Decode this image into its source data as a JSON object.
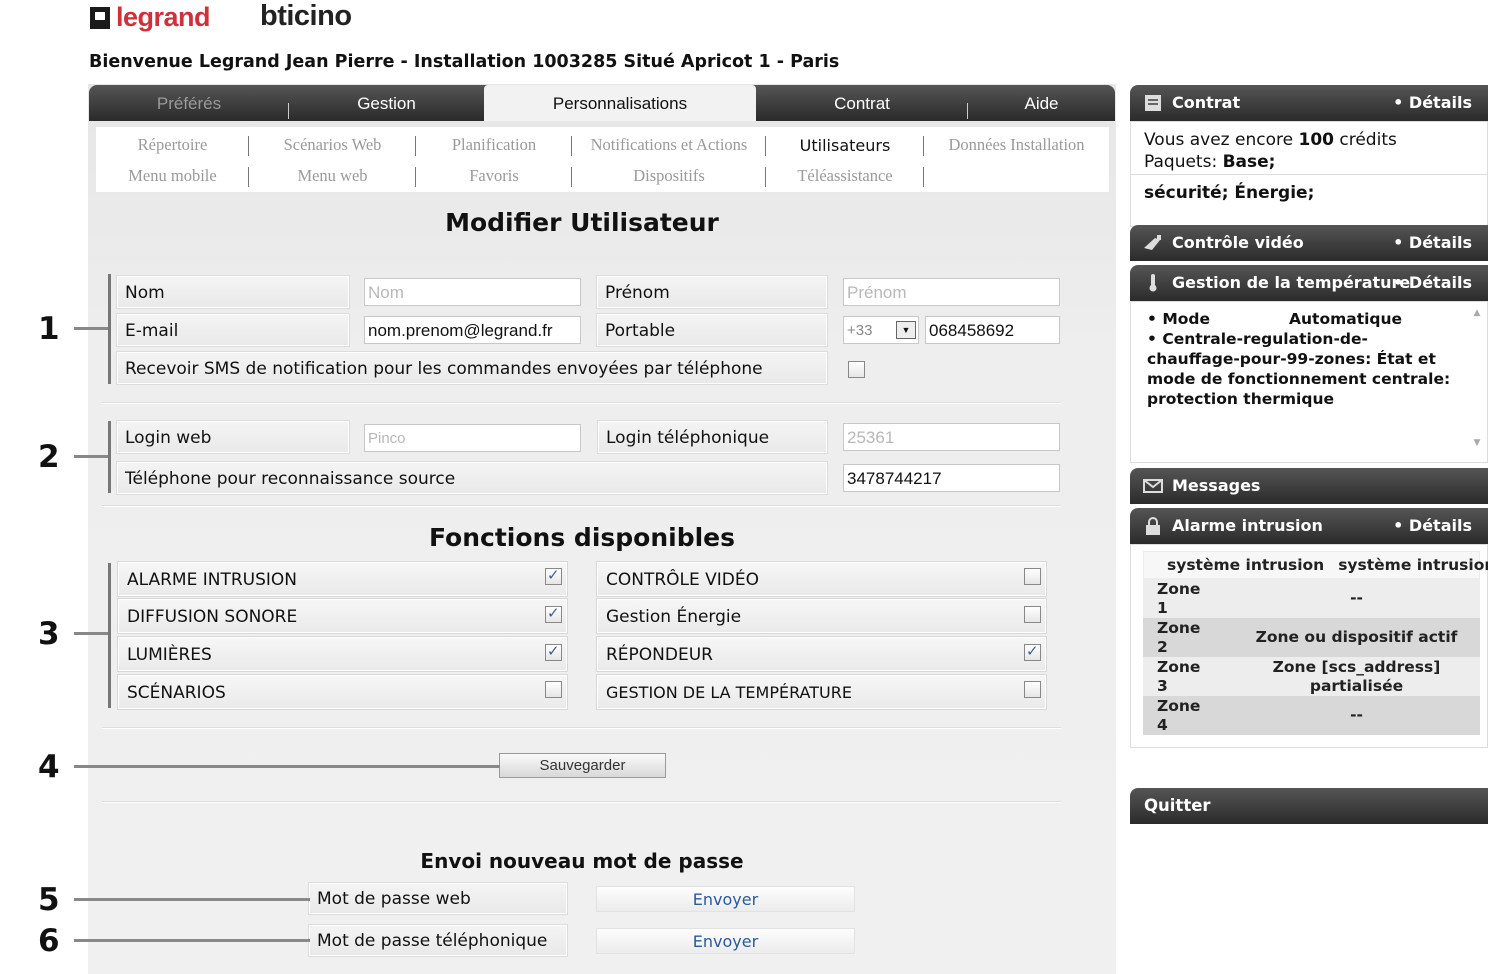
{
  "brand": {
    "logo1": "legrand",
    "logo2": "bticino"
  },
  "welcome": "Bienvenue Legrand Jean Pierre - Installation 1003285 Situé Apricot 1 - Paris",
  "tabs": [
    "Préférés",
    "Gestion",
    "Personnalisations",
    "Contrat",
    "Aide"
  ],
  "subnav": {
    "row1": [
      "Répertoire",
      "Scénarios Web",
      "Planification",
      "Notifications et Actions",
      "Utilisateurs",
      "Données Installation"
    ],
    "row2": [
      "Menu mobile",
      "Menu web",
      "Favoris",
      "Dispositifs",
      "Téléassistance"
    ]
  },
  "form": {
    "title": "Modifier Utilisateur",
    "nom_label": "Nom",
    "nom_placeholder": "Nom",
    "prenom_label": "Prénom",
    "prenom_placeholder": "Prénom",
    "email_label": "E-mail",
    "email_value": "nom.prenom@legrand.fr",
    "portable_label": "Portable",
    "country_code": "+33",
    "portable_value": "068458692",
    "sms_label": "Recevoir SMS de notification pour les commandes envoyées par téléphone",
    "login_web_label": "Login web",
    "login_web_placeholder": "Pinco",
    "login_tel_label": "Login téléphonique",
    "login_tel_value": "25361",
    "tel_source_label": "Téléphone pour reconnaissance source",
    "tel_source_value": "3478744217"
  },
  "functions": {
    "title": "Fonctions disponibles",
    "items": [
      {
        "label": "ALARME INTRUSION",
        "checked": true
      },
      {
        "label": "CONTRÔLE VIDÉO",
        "checked": false
      },
      {
        "label": "DIFFUSION SONORE",
        "checked": true
      },
      {
        "label": "Gestion Énergie",
        "checked": false
      },
      {
        "label": "LUMIÈRES",
        "checked": true
      },
      {
        "label": "RÉPONDEUR",
        "checked": true
      },
      {
        "label": "SCÉNARIOS",
        "checked": false
      },
      {
        "label": "GESTION DE LA TEMPÉRATURE",
        "checked": false
      }
    ]
  },
  "save_label": "Sauvegarder",
  "password": {
    "title": "Envoi nouveau mot de passe",
    "web_label": "Mot de passe web",
    "tel_label": "Mot de passe téléphonique",
    "send_label": "Envoyer"
  },
  "callouts": [
    "1",
    "2",
    "3",
    "4",
    "5",
    "6"
  ],
  "sidebar": {
    "contrat": {
      "title": "Contrat",
      "details": "Détails",
      "credits_prefix": "Vous avez encore",
      "credits": "100",
      "credits_suffix": "crédits",
      "packages_label": "Paquets:",
      "packages_value": "Base;",
      "services": "sécurité; Énergie;"
    },
    "video": {
      "title": "Contrôle vidéo",
      "details": "Détails"
    },
    "temperature": {
      "title": "Gestion de la température",
      "details": "Détails",
      "mode_label": "Mode",
      "mode_value": "Automatique",
      "central_text": "Centrale-regulation-de-chauffage-pour-99-zones: État et mode de fonctionnement centrale: protection thermique"
    },
    "messages": {
      "title": "Messages"
    },
    "alarm": {
      "title": "Alarme intrusion",
      "details": "Détails",
      "col1": "système intrusion",
      "col2": "système intrusion",
      "zones": [
        {
          "name": "Zone 1",
          "value": "--"
        },
        {
          "name": "Zone 2",
          "value": "Zone ou dispositif actif"
        },
        {
          "name": "Zone 3",
          "value": "Zone [scs_address] partialisée"
        },
        {
          "name": "Zone 4",
          "value": "--"
        }
      ]
    },
    "quit": "Quitter"
  }
}
